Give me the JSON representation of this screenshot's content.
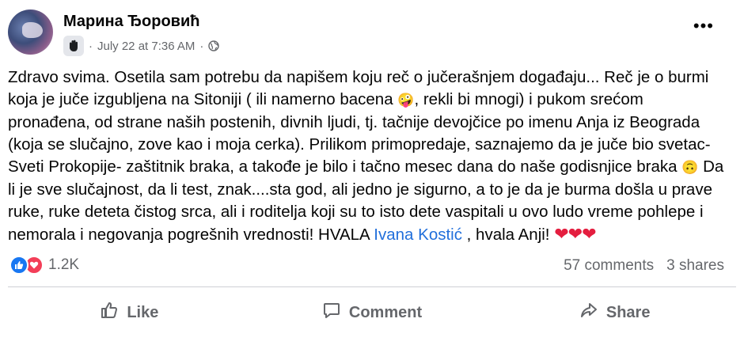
{
  "post": {
    "author": "Марина Ђоровић",
    "timestamp": "July 22 at 7:36 AM",
    "separator": "·",
    "audience_icon": "globe-icon",
    "more_icon": "more-options-icon",
    "body": {
      "line1": "Zdravo svima. Osetila sam potrebu da napišem koju reč o jučerašnjem događaju... Reč je o burmi koja je juče izgubljena na Sitoniji ( ili namerno bacena ",
      "emoji1": "🤪",
      "line2": ", rekli bi mnogi) i pukom srećom pronađena, od strane naših postenih, divnih ljudi, tj. tačnije devojčice po imenu Anja iz Beograda (koja se slučajno, zove kao i moja cerka). Prilikom primopredaje, saznajemo da je juče bio svetac- Sveti Prokopije- zaštitnik braka, a takođe je bilo i tačno mesec dana do naše godisnjice braka ",
      "emoji2": "🙃",
      "line3": " Da li je sve slučajnost,  da  li test, znak....sta god, ali jedno je sigurno, a to je da je burma došla u prave ruke, ruke deteta čistog srca, ali i roditelja koji su to isto dete vaspitali u ovo ludo vreme pohlepe i nemorala i  negovanja pogrešnih vrednosti! HVALA ",
      "mention": "Ivana Kostić",
      "line4": " , hvala Anji! ",
      "hearts": "❤❤❤"
    }
  },
  "reactions": {
    "count": "1.2K",
    "types": [
      "like-icon",
      "love-icon"
    ]
  },
  "stats": {
    "comments": "57 comments",
    "shares": "3 shares"
  },
  "actions": {
    "like": "Like",
    "comment": "Comment",
    "share": "Share"
  },
  "colors": {
    "mention": "#216fdb",
    "secondary_text": "#65676b",
    "like_blue": "#1877f2",
    "love_red": "#f33e58",
    "heart_red": "#e41e3f"
  }
}
